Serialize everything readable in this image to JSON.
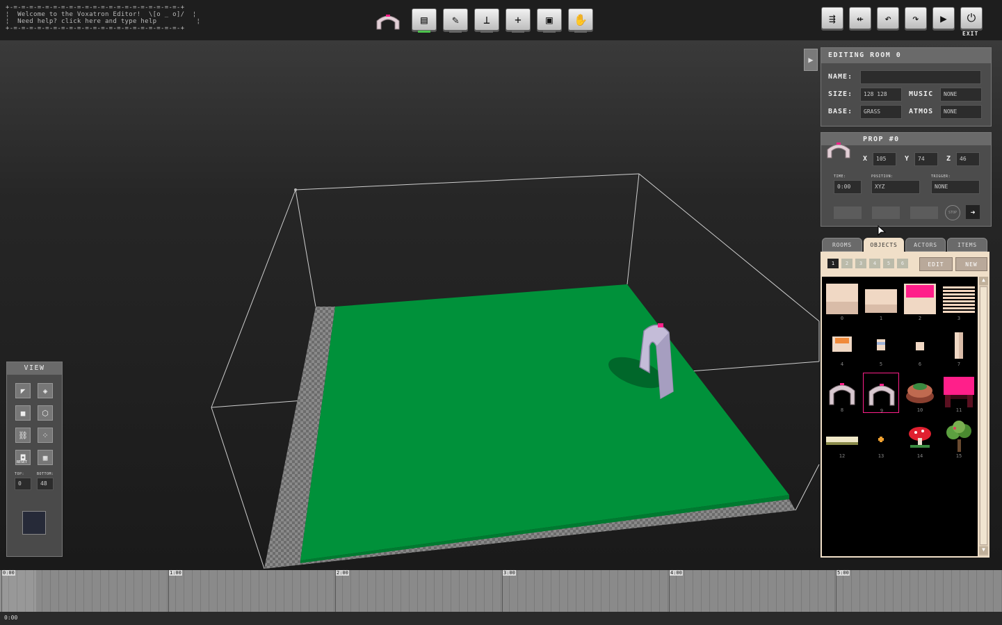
{
  "welcome": {
    "border_top": "+-=-=-=-=-=-=-=-=-=-=-=-=-=-=-=-=-=-=-=-=-=-+",
    "line1": "¦  Welcome to the Voxatron Editor!  \\[o _ o]/  ¦",
    "line2": "¦  Need help? click here and type help          ¦",
    "border_bottom": "+-=-=-=-=-=-=-=-=-=-=-=-=-=-=-=-=-=-=-=-=-=-+"
  },
  "toolbar": {
    "tools": [
      {
        "name": "select-tool",
        "icon": "layers-icon",
        "glyph": "▤",
        "active": true
      },
      {
        "name": "pencil-tool",
        "icon": "pencil-icon",
        "glyph": "✎",
        "active": false
      },
      {
        "name": "stamp-tool",
        "icon": "stamp-icon",
        "glyph": "⊥",
        "active": false
      },
      {
        "name": "add-tool",
        "icon": "plus-icon",
        "glyph": "+",
        "active": false
      },
      {
        "name": "camera-tool",
        "icon": "camera-icon",
        "glyph": "▣",
        "active": false
      },
      {
        "name": "hand-tool",
        "icon": "hand-icon",
        "glyph": "✋",
        "active": false
      }
    ],
    "right": [
      {
        "name": "save-button",
        "icon": "save-icon",
        "glyph": "⇶"
      },
      {
        "name": "load-button",
        "icon": "load-icon",
        "glyph": "⇷"
      },
      {
        "name": "undo-button",
        "icon": "undo-icon",
        "glyph": "↶"
      },
      {
        "name": "redo-button",
        "icon": "redo-icon",
        "glyph": "↷"
      },
      {
        "name": "play-button",
        "icon": "play-icon",
        "glyph": "▶"
      },
      {
        "name": "exit-button",
        "icon": "power-icon",
        "glyph": "⏻"
      }
    ],
    "exit_label": "EXIT"
  },
  "room": {
    "title": "EDITING ROOM 0",
    "name_label": "NAME:",
    "name_value": "",
    "size_label": "SIZE:",
    "size_value": "128 128",
    "music_label": "MUSIC",
    "music_value": "NONE",
    "base_label": "BASE:",
    "base_value": "GRASS",
    "atmos_label": "ATMOS",
    "atmos_value": "NONE"
  },
  "prop": {
    "title": "PROP #0",
    "x_label": "X",
    "x_value": "105",
    "y_label": "Y",
    "y_value": "74",
    "z_label": "Z",
    "z_value": "46",
    "time_label": "TIME:",
    "time_value": "0:00",
    "position_label": "POSITION:",
    "position_value": "XYZ",
    "trigger_label": "TRIGGER:",
    "trigger_value": "NONE",
    "stop_label": "STOP"
  },
  "tabs": [
    "ROOMS",
    "OBJECTS",
    "ACTORS",
    "ITEMS"
  ],
  "active_tab": "OBJECTS",
  "pages": [
    "1",
    "2",
    "3",
    "4",
    "5",
    "6"
  ],
  "edit_label": "EDIT",
  "new_label": "NEW",
  "objects": [
    {
      "num": "0",
      "kind": "block",
      "color": "#f0d8c4"
    },
    {
      "num": "1",
      "kind": "slab",
      "color": "#f0d8c4"
    },
    {
      "num": "2",
      "kind": "pink-block",
      "color": "#ff1f8a"
    },
    {
      "num": "3",
      "kind": "striped",
      "color": "#f6d7c0"
    },
    {
      "num": "4",
      "kind": "crate",
      "color": "#f08a3a"
    },
    {
      "num": "5",
      "kind": "small-box",
      "color": "#9fb3d8"
    },
    {
      "num": "6",
      "kind": "tiny-box",
      "color": "#f0d8c4"
    },
    {
      "num": "7",
      "kind": "pillar",
      "color": "#f0d8c4"
    },
    {
      "num": "8",
      "kind": "arch",
      "color": "#d8c8d0"
    },
    {
      "num": "9",
      "kind": "arch",
      "color": "#d8c8d0"
    },
    {
      "num": "10",
      "kind": "cake",
      "color": "#c06a50"
    },
    {
      "num": "11",
      "kind": "table",
      "color": "#ff1f8a"
    },
    {
      "num": "12",
      "kind": "plank",
      "color": "#f0e8c8"
    },
    {
      "num": "13",
      "kind": "flower",
      "color": "#f0a030"
    },
    {
      "num": "14",
      "kind": "mushroom",
      "color": "#e02030"
    },
    {
      "num": "15",
      "kind": "tree",
      "color": "#5ca040"
    }
  ],
  "selected_object": "9",
  "view": {
    "title": "VIEW",
    "top_label": "TOP:",
    "top_value": "0",
    "bottom_label": "BOTTOM:",
    "bottom_value": "48",
    "buttons": [
      "camera-icon",
      "perspective-icon",
      "block-icon",
      "cube-icon",
      "link-icon",
      "grid-dots-icon",
      "reset-camera-icon",
      "grid-icon"
    ],
    "reset_label": "RESET"
  },
  "timeline": {
    "marks": [
      "0:00",
      "1:00",
      "2:00",
      "3:00",
      "4:00",
      "5:00"
    ]
  },
  "status": {
    "time": "0:00"
  },
  "colors": {
    "grass": "#00913a",
    "accent_pink": "#ff1f8a",
    "panel_cream": "#f0dfc8"
  }
}
